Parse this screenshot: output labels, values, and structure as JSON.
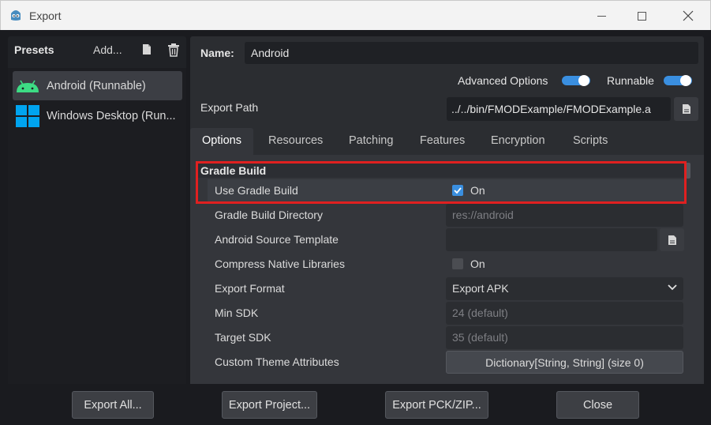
{
  "window": {
    "title": "Export"
  },
  "presets": {
    "label": "Presets",
    "add_label": "Add...",
    "items": [
      {
        "label": "Android (Runnable)",
        "icon": "android-icon",
        "selected": true
      },
      {
        "label": "Windows Desktop (Run...",
        "icon": "windows-icon",
        "selected": false
      }
    ]
  },
  "details": {
    "name_label": "Name:",
    "name_value": "Android",
    "advanced_options_label": "Advanced Options",
    "advanced_options_on": true,
    "runnable_label": "Runnable",
    "runnable_on": true,
    "export_path_label": "Export Path",
    "export_path_value": "../../bin/FMODExample/FMODExample.a"
  },
  "tabs": [
    "Options",
    "Resources",
    "Patching",
    "Features",
    "Encryption",
    "Scripts"
  ],
  "active_tab": "Options",
  "options": {
    "section_title": "Gradle Build",
    "rows": [
      {
        "label": "Use Gradle Build",
        "value": "On",
        "type": "checkbox",
        "checked": true
      },
      {
        "label": "Gradle Build Directory",
        "value": "res://android",
        "type": "placeholder"
      },
      {
        "label": "Android Source Template",
        "value": "",
        "type": "file"
      },
      {
        "label": "Compress Native Libraries",
        "value": "On",
        "type": "checkbox",
        "checked": false
      },
      {
        "label": "Export Format",
        "value": "Export APK",
        "type": "dropdown"
      },
      {
        "label": "Min SDK",
        "value": "24 (default)",
        "type": "placeholder"
      },
      {
        "label": "Target SDK",
        "value": "35 (default)",
        "type": "placeholder"
      },
      {
        "label": "Custom Theme Attributes",
        "value": "Dictionary[String, String] (size 0)",
        "type": "button"
      }
    ]
  },
  "footer": {
    "export_all": "Export All...",
    "export_project": "Export Project...",
    "export_pck": "Export PCK/ZIP...",
    "close": "Close"
  },
  "colors": {
    "accent": "#3a8fe0",
    "highlight": "#e02020",
    "android_green": "#3ddc84",
    "windows_blue": "#00a4ef"
  }
}
